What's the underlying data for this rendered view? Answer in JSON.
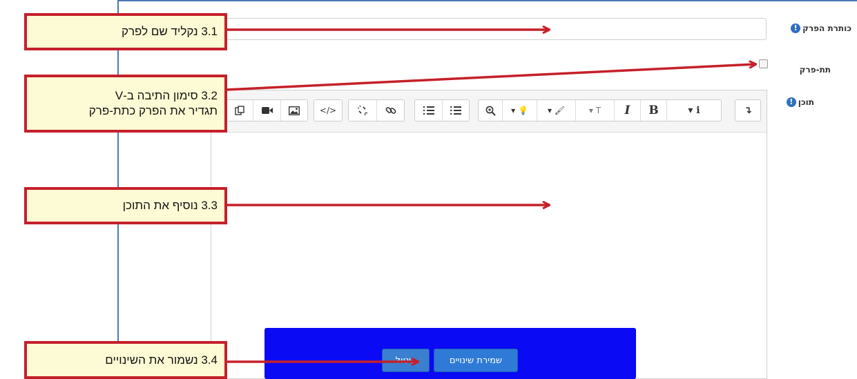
{
  "form": {
    "title_label": "כותרת הפרק",
    "subchapter_label": "תת-פרק",
    "content_label": "תוכן",
    "help_glyph": "!",
    "title_value": "",
    "subchapter_checked": false
  },
  "toolbar": {
    "icons": [
      "copy-icon",
      "video-icon",
      "image-icon",
      "code-icon",
      "unlink-icon",
      "link-icon",
      "ordered-list-icon",
      "unordered-list-icon",
      "zoom-icon",
      "lightbulb-dropdown-icon",
      "brush-dropdown-icon",
      "font-size-dropdown-icon",
      "italic-icon",
      "bold-icon",
      "info-dropdown-icon",
      "collapse-icon"
    ],
    "italic_label": "I",
    "bold_label": "B",
    "info_label": "i"
  },
  "buttons": {
    "save_label": "שמירת שינויים",
    "cancel_label": "ביטול"
  },
  "callouts": [
    {
      "lines": [
        "3.1 נקליד שם לפרק"
      ]
    },
    {
      "lines": [
        "3.2 סימון התיבה ב-V",
        "תגדיר את הפרק כתת-פרק"
      ]
    },
    {
      "lines": [
        "3.3 נוסיף את התוכן"
      ]
    },
    {
      "lines": [
        "3.4 נשמור את השינויים"
      ]
    }
  ],
  "colors": {
    "callout_border": "#c5202a",
    "callout_fill": "#fdfbd5",
    "save_area": "#0a0af5",
    "accent": "#2f7ad6"
  }
}
